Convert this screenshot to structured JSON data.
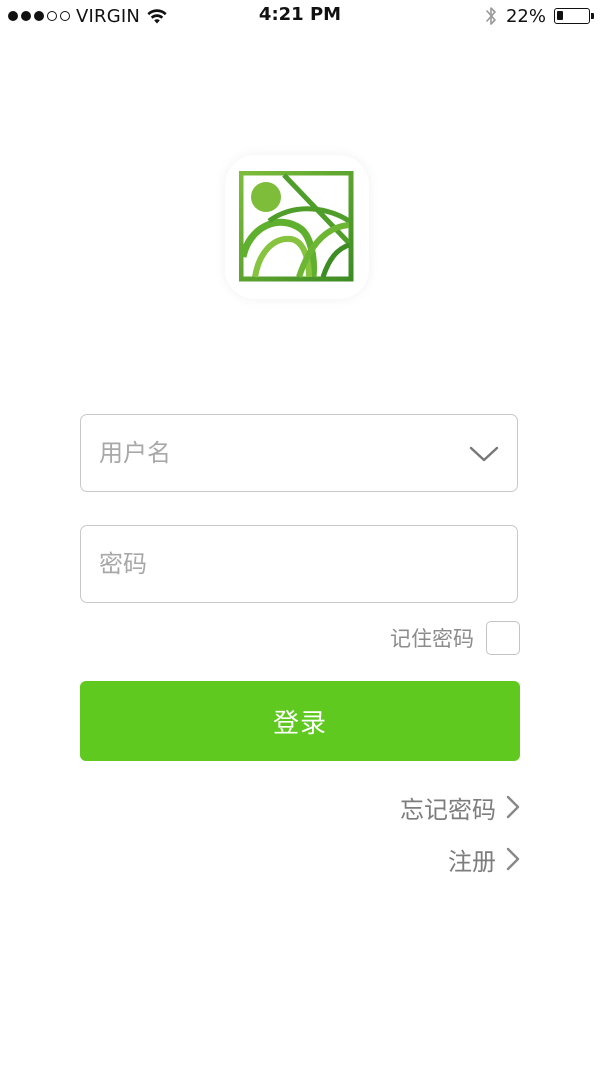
{
  "status_bar": {
    "carrier": "VIRGIN",
    "time": "4:21 PM",
    "battery_text": "22%",
    "battery_level": 0.22,
    "signal_bars_filled": 3,
    "signal_bars_total": 5
  },
  "form": {
    "username_placeholder": "用户名",
    "password_placeholder": "密码",
    "remember_label": "记住密码",
    "login_label": "登录"
  },
  "links": {
    "forgot_label": "忘记密码",
    "register_label": "注册"
  },
  "colors": {
    "accent": "#5fc920",
    "logo_green_dark": "#3d8c24",
    "logo_green_light": "#7dbd3a"
  }
}
